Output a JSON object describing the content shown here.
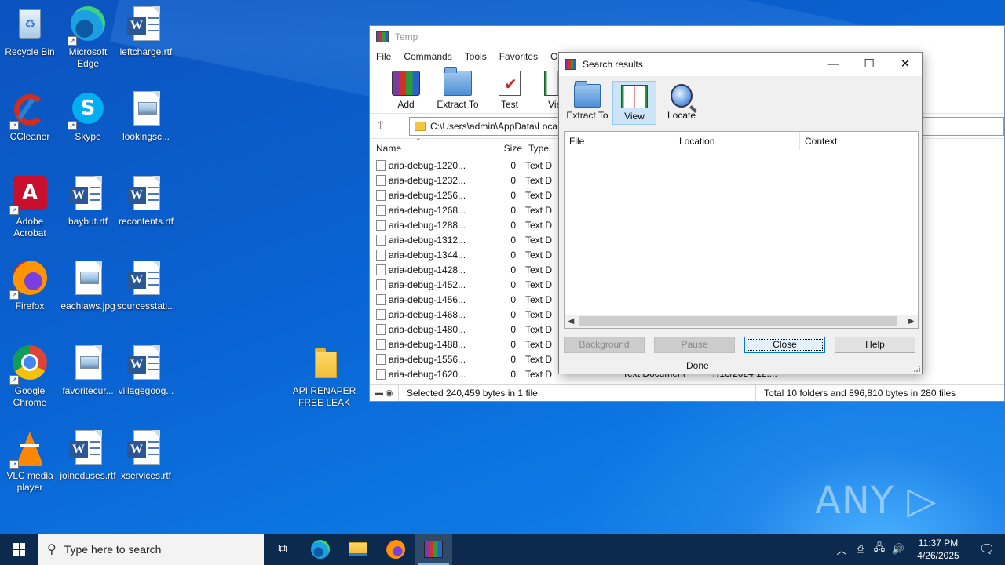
{
  "desktop": {
    "icons": [
      {
        "label": "Recycle Bin",
        "icon": "recycle-bin-icon"
      },
      {
        "label": "Microsoft Edge",
        "icon": "edge-icon"
      },
      {
        "label": "leftcharge.rtf",
        "icon": "word-document-icon"
      },
      {
        "label": "CCleaner",
        "icon": "ccleaner-icon"
      },
      {
        "label": "Skype",
        "icon": "skype-icon"
      },
      {
        "label": "lookingsc...",
        "icon": "image-file-icon"
      },
      {
        "label": "Adobe Acrobat",
        "icon": "acrobat-icon"
      },
      {
        "label": "baybut.rtf",
        "icon": "word-document-icon"
      },
      {
        "label": "recontents.rtf",
        "icon": "word-document-icon"
      },
      {
        "label": "Firefox",
        "icon": "firefox-icon"
      },
      {
        "label": "eachlaws.jpg",
        "icon": "image-file-icon"
      },
      {
        "label": "sourcesstati...",
        "icon": "word-document-icon"
      },
      {
        "label": "Google Chrome",
        "icon": "chrome-icon"
      },
      {
        "label": "favoritecur...",
        "icon": "image-file-icon"
      },
      {
        "label": "villagegoog...",
        "icon": "word-document-icon"
      },
      {
        "label": "VLC media player",
        "icon": "vlc-icon"
      },
      {
        "label": "joineduses.rtf",
        "icon": "word-document-icon"
      },
      {
        "label": "xservices.rtf",
        "icon": "word-document-icon"
      },
      {
        "label": "API RENAPER FREE LEAK",
        "icon": "folder-icon"
      }
    ]
  },
  "winrar": {
    "title": "Temp",
    "menu": [
      "File",
      "Commands",
      "Tools",
      "Favorites",
      "Opti"
    ],
    "toolbar": [
      "Add",
      "Extract To",
      "Test",
      "View"
    ],
    "address": "C:\\Users\\admin\\AppData\\Loca",
    "columns": {
      "name": "Name",
      "size": "Size",
      "type": "Type"
    },
    "files": [
      {
        "name": "aria-debug-1220...",
        "size": "0",
        "type": "Text D"
      },
      {
        "name": "aria-debug-1232...",
        "size": "0",
        "type": "Text D"
      },
      {
        "name": "aria-debug-1256...",
        "size": "0",
        "type": "Text D"
      },
      {
        "name": "aria-debug-1268...",
        "size": "0",
        "type": "Text D"
      },
      {
        "name": "aria-debug-1288...",
        "size": "0",
        "type": "Text D"
      },
      {
        "name": "aria-debug-1312...",
        "size": "0",
        "type": "Text D"
      },
      {
        "name": "aria-debug-1344...",
        "size": "0",
        "type": "Text D"
      },
      {
        "name": "aria-debug-1428...",
        "size": "0",
        "type": "Text D"
      },
      {
        "name": "aria-debug-1452...",
        "size": "0",
        "type": "Text D"
      },
      {
        "name": "aria-debug-1456...",
        "size": "0",
        "type": "Text D"
      },
      {
        "name": "aria-debug-1468...",
        "size": "0",
        "type": "Text D"
      },
      {
        "name": "aria-debug-1480...",
        "size": "0",
        "type": "Text D"
      },
      {
        "name": "aria-debug-1488...",
        "size": "0",
        "type": "Text D"
      },
      {
        "name": "aria-debug-1556...",
        "size": "0",
        "type": "Text D"
      },
      {
        "name": "aria-debug-1620...",
        "size": "0",
        "type": "Text D"
      }
    ],
    "last_row_type_full": "Text Document",
    "last_row_modified": "7/16/2024 12:...",
    "status_left": "Selected 240,459 bytes in 1 file",
    "status_right": "Total 10 folders and 896,810 bytes in 280 files"
  },
  "search_dialog": {
    "title": "Search results",
    "toolbar": [
      "Extract To",
      "View",
      "Locate"
    ],
    "columns": [
      "File",
      "Location",
      "Context"
    ],
    "buttons": {
      "background": "Background",
      "pause": "Pause",
      "close": "Close",
      "help": "Help"
    },
    "status": "Done"
  },
  "watermark": "ANY ▷ RUN",
  "taskbar": {
    "search_placeholder": "Type here to search",
    "time": "11:37 PM",
    "date": "4/26/2025"
  }
}
